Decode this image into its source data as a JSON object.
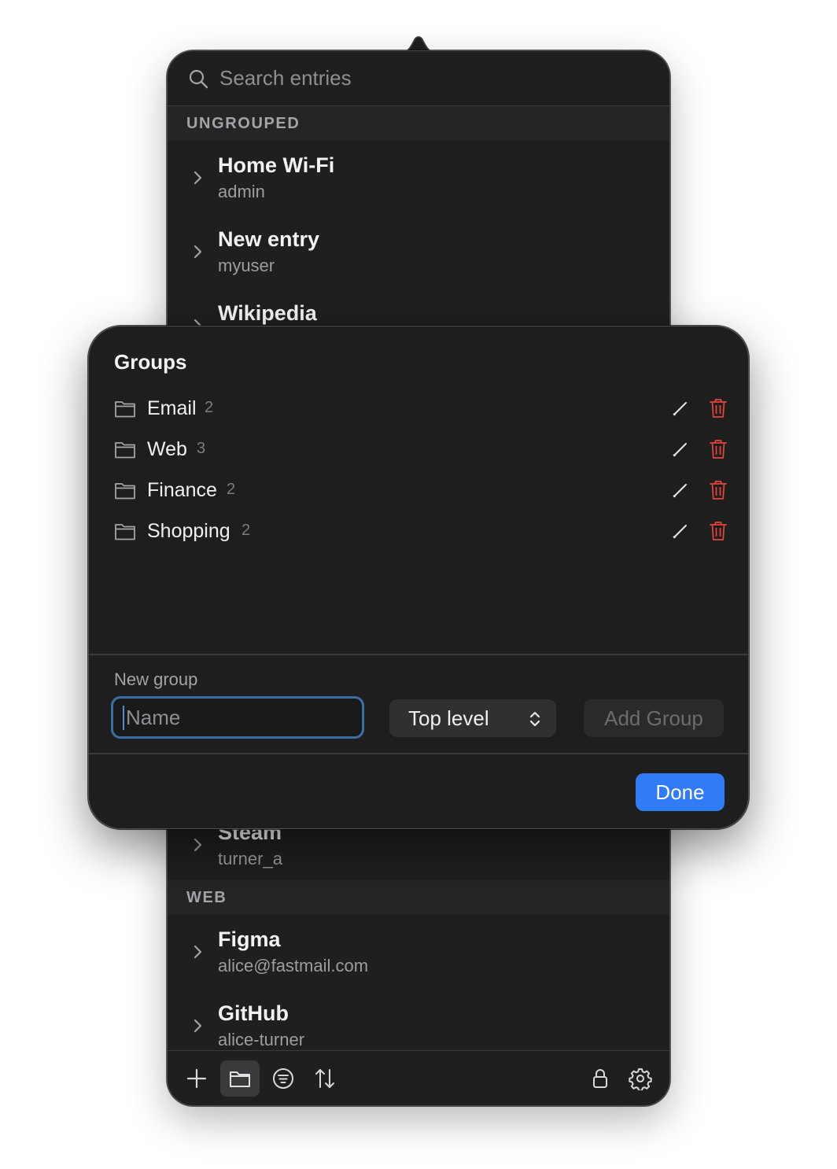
{
  "search": {
    "placeholder": "Search entries"
  },
  "sections": {
    "ungrouped": "UNGROUPED",
    "web": "WEB"
  },
  "entries_top": [
    {
      "title": "Home Wi-Fi",
      "user": "admin"
    },
    {
      "title": "New entry",
      "user": "myuser"
    },
    {
      "title": "Wikipedia"
    }
  ],
  "entries_mid": [
    {
      "title": "Steam",
      "user": "turner_a"
    }
  ],
  "entries_web": [
    {
      "title": "Figma",
      "user": "alice@fastmail.com"
    },
    {
      "title": "GitHub",
      "user": "alice-turner"
    }
  ],
  "toolbar": {
    "buttons": [
      "plus-icon",
      "folder-icon",
      "filter-icon",
      "sort-icon",
      "lock-icon",
      "gear-icon"
    ],
    "active": "folder-icon"
  },
  "groups_sheet": {
    "title": "Groups",
    "groups": [
      {
        "name": "Email",
        "count": "2"
      },
      {
        "name": "Web",
        "count": "3"
      },
      {
        "name": "Finance",
        "count": "2"
      },
      {
        "name": "Shopping",
        "count": "2"
      }
    ],
    "new_group_label": "New group",
    "name_placeholder": "Name",
    "name_value": "",
    "parent_select": "Top level",
    "add_button": "Add Group",
    "done_button": "Done"
  },
  "colors": {
    "panel": "#1f1f20",
    "sheet": "#1e1e1f",
    "accent": "#2f7cf6",
    "focus_ring": "#3b6ea5",
    "delete": "#e0453c"
  }
}
